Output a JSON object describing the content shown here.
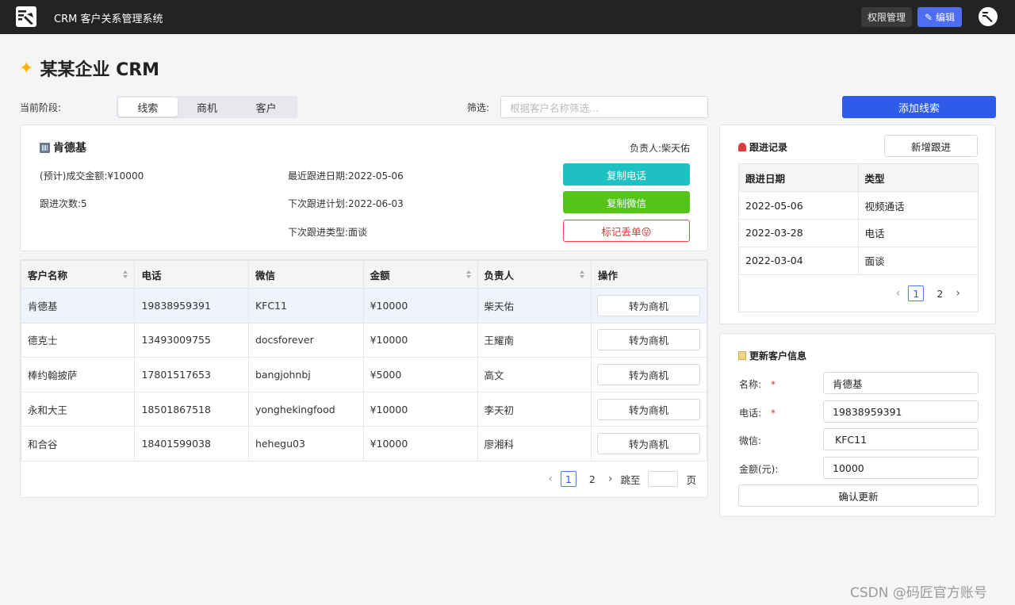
{
  "topbar": {
    "app_title": "CRM 客户关系管理系统",
    "permission_label": "权限管理",
    "edit_label": "编辑"
  },
  "page": {
    "title": "某某企业 CRM"
  },
  "toolbar": {
    "stage_label": "当前阶段:",
    "stages": [
      "线索",
      "商机",
      "客户"
    ],
    "active_stage": "线索",
    "filter_label": "筛选:",
    "filter_placeholder": "根据客户名称筛选...",
    "add_lead_label": "添加线索"
  },
  "detail": {
    "name": "肯德基",
    "owner_text": "负责人:柴天佑",
    "amount_text": "(预计)成交金额:¥10000",
    "follow_count_text": "跟进次数:5",
    "last_follow_text": "最近跟进日期:2022-05-06",
    "next_plan_text": "下次跟进计划:2022-06-03",
    "next_type_text": "下次跟进类型:面谈",
    "copy_phone_label": "复制电话",
    "copy_wechat_label": "复制微信",
    "mark_lost_label": "标记丢单😝",
    "colors": {
      "copy_phone": "#1ec1c3",
      "copy_wechat": "#52c41a",
      "mark_lost": "#f04848"
    }
  },
  "table": {
    "headers": [
      "客户名称",
      "电话",
      "微信",
      "金额",
      "负责人",
      "操作"
    ],
    "action_label": "转为商机",
    "rows": [
      [
        "肯德基",
        "19838959391",
        "KFC11",
        "¥10000",
        "柴天佑"
      ],
      [
        "德克士",
        "13493009755",
        "docsforever",
        "¥10000",
        "王耀南"
      ],
      [
        "棒约翰披萨",
        "17801517653",
        "bangjohnbj",
        "¥5000",
        "高文"
      ],
      [
        "永和大王",
        "18501867518",
        "yonghekingfood",
        "¥10000",
        "李天初"
      ],
      [
        "和合谷",
        "18401599038",
        "hehegu03",
        "¥10000",
        "廖湘科"
      ]
    ],
    "pager": {
      "pages": [
        "1",
        "2"
      ],
      "current": "1",
      "jump_label": "跳至",
      "page_suffix": "页"
    }
  },
  "follow": {
    "title": "跟进记录",
    "new_label": "新增跟进",
    "headers": [
      "跟进日期",
      "类型"
    ],
    "rows": [
      [
        "2022-05-06",
        "视频通话"
      ],
      [
        "2022-03-28",
        "电话"
      ],
      [
        "2022-03-04",
        "面谈"
      ]
    ],
    "pager": {
      "pages": [
        "1",
        "2"
      ],
      "current": "1"
    }
  },
  "update": {
    "title": "更新客户信息",
    "name_label": "名称:",
    "name_value": "肯德基",
    "phone_label": "电话:",
    "phone_value": "19838959391",
    "wechat_label": "微信:",
    "wechat_value": "KFC11",
    "amount_label": "金额(元):",
    "amount_value": "10000",
    "required_mark": "*",
    "confirm_label": "确认更新"
  },
  "watermark": "CSDN @码匠官方账号"
}
